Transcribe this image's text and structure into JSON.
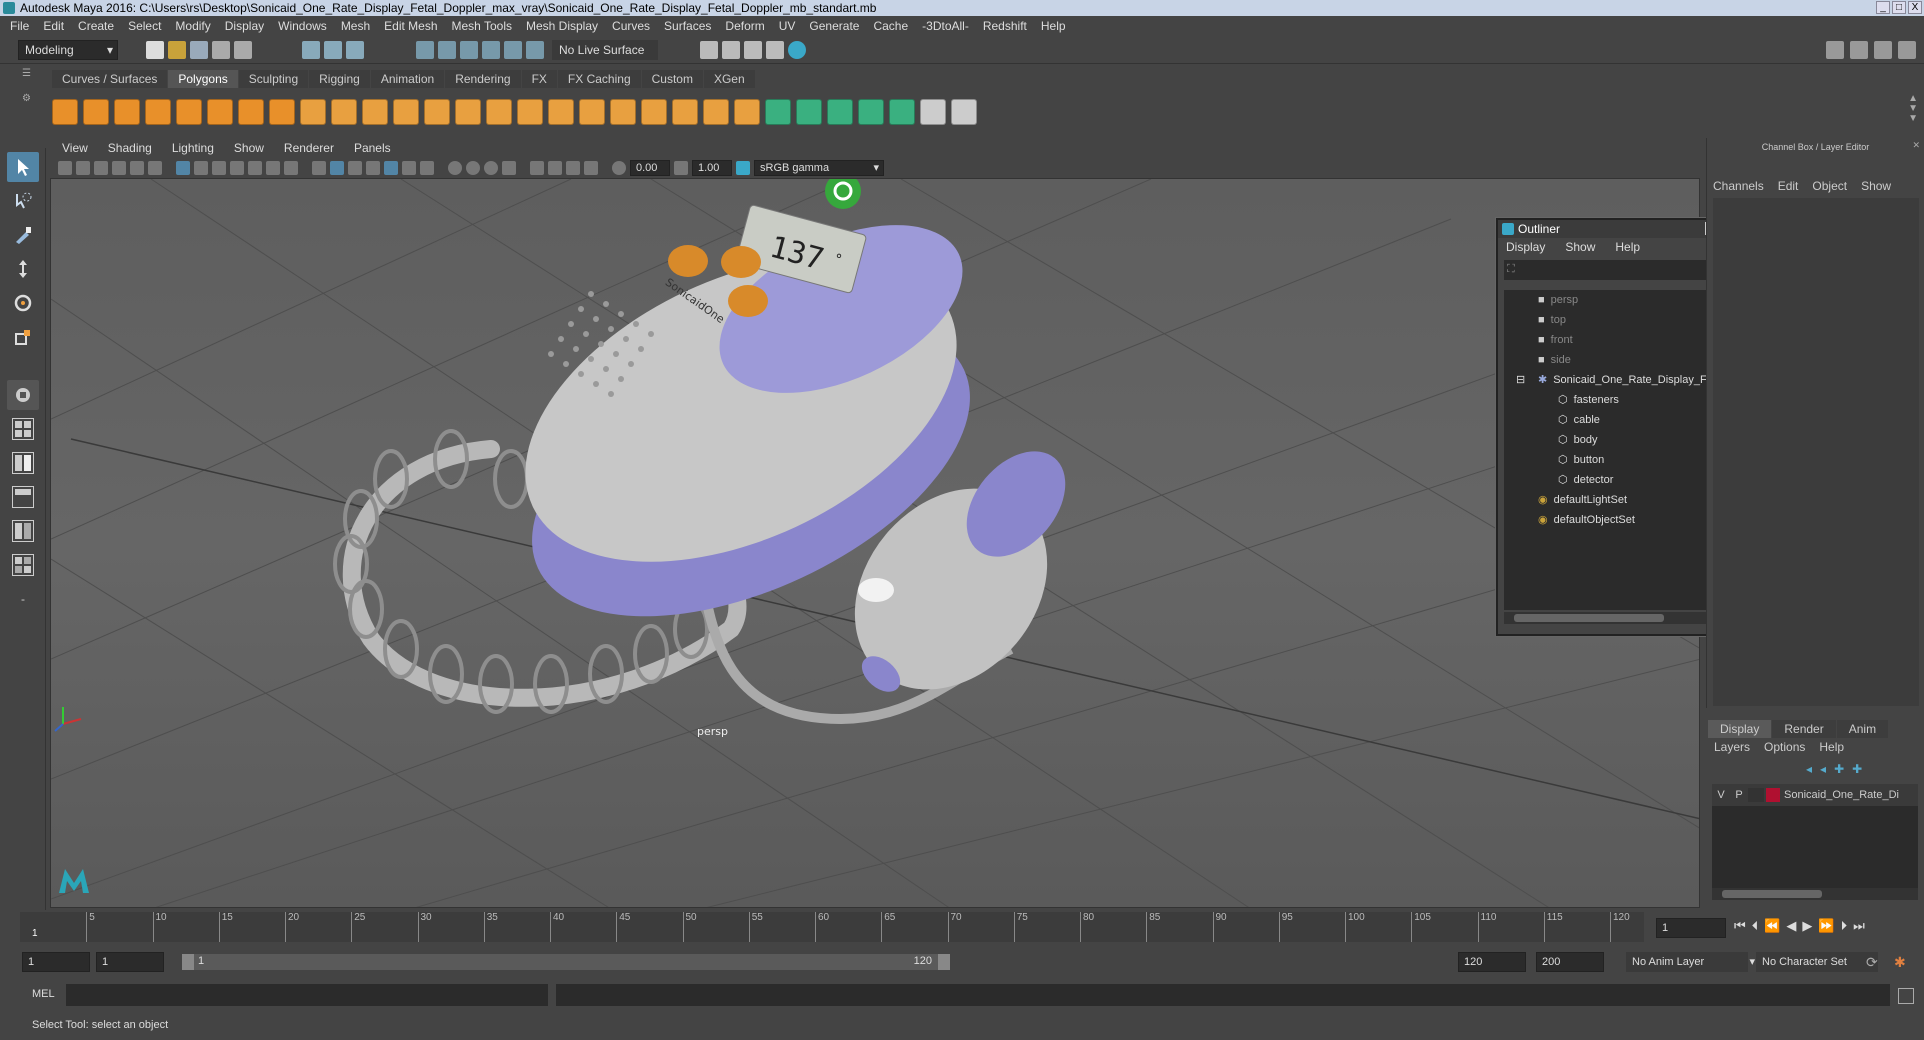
{
  "window": {
    "title": "Autodesk Maya 2016: C:\\Users\\rs\\Desktop\\Sonicaid_One_Rate_Display_Fetal_Doppler_max_vray\\Sonicaid_One_Rate_Display_Fetal_Doppler_mb_standart.mb",
    "buttons": [
      "_",
      "□",
      "X"
    ]
  },
  "menu": [
    "File",
    "Edit",
    "Create",
    "Select",
    "Modify",
    "Display",
    "Windows",
    "Mesh",
    "Edit Mesh",
    "Mesh Tools",
    "Mesh Display",
    "Curves",
    "Surfaces",
    "Deform",
    "UV",
    "Generate",
    "Cache",
    "-3DtoAll-",
    "Redshift",
    "Help"
  ],
  "statusline": {
    "mode": "Modeling",
    "live_surface": "No Live Surface"
  },
  "shelf": {
    "tabs": [
      "Curves / Surfaces",
      "Polygons",
      "Sculpting",
      "Rigging",
      "Animation",
      "Rendering",
      "FX",
      "FX Caching",
      "Custom",
      "XGen"
    ],
    "active_tab": "Polygons",
    "icon_colors": [
      "#e8902a",
      "#e8902a",
      "#e8902a",
      "#e8902a",
      "#e8902a",
      "#e8902a",
      "#e8902a",
      "#e8902a",
      "#e8a040",
      "#e8a040",
      "#e8a040",
      "#e8a040",
      "#e8a040",
      "#e8a040",
      "#e8a040",
      "#e8a040",
      "#e8a040",
      "#e8a040",
      "#e8a040",
      "#e8a040",
      "#e8a040",
      "#e8a040",
      "#e8a040",
      "#3ab080",
      "#3ab080",
      "#3ab080",
      "#3ab080",
      "#3ab080",
      "#cccccc",
      "#cccccc"
    ]
  },
  "viewport": {
    "menu": [
      "View",
      "Shading",
      "Lighting",
      "Show",
      "Renderer",
      "Panels"
    ],
    "exposure": "0.00",
    "gamma": "1.00",
    "colorspace": "sRGB gamma",
    "camera_label": "persp",
    "device": {
      "display": "137",
      "unit": "°",
      "brand": "SonicaidOne"
    }
  },
  "outliner": {
    "title": "Outliner",
    "menu": [
      "Display",
      "Show",
      "Help"
    ],
    "items": [
      {
        "label": "persp",
        "indent": 1,
        "dim": true,
        "icon": "camera-icon"
      },
      {
        "label": "top",
        "indent": 1,
        "dim": true,
        "icon": "camera-icon"
      },
      {
        "label": "front",
        "indent": 1,
        "dim": true,
        "icon": "camera-icon"
      },
      {
        "label": "side",
        "indent": 1,
        "dim": true,
        "icon": "camera-icon"
      },
      {
        "label": "Sonicaid_One_Rate_Display_Fetal",
        "indent": 1,
        "dim": false,
        "icon": "group-icon"
      },
      {
        "label": "fasteners",
        "indent": 2,
        "dim": false,
        "icon": "mesh-icon"
      },
      {
        "label": "cable",
        "indent": 2,
        "dim": false,
        "icon": "mesh-icon"
      },
      {
        "label": "body",
        "indent": 2,
        "dim": false,
        "icon": "mesh-icon"
      },
      {
        "label": "button",
        "indent": 2,
        "dim": false,
        "icon": "mesh-icon"
      },
      {
        "label": "detector",
        "indent": 2,
        "dim": false,
        "icon": "mesh-icon"
      },
      {
        "label": "defaultLightSet",
        "indent": 1,
        "dim": false,
        "icon": "set-icon"
      },
      {
        "label": "defaultObjectSet",
        "indent": 1,
        "dim": false,
        "icon": "set-icon"
      }
    ]
  },
  "channelbox": {
    "title": "Channel Box / Layer Editor",
    "menu": [
      "Channels",
      "Edit",
      "Object",
      "Show"
    ]
  },
  "layers": {
    "tabs": [
      "Display",
      "Render",
      "Anim"
    ],
    "active_tab": "Display",
    "menu": [
      "Layers",
      "Options",
      "Help"
    ],
    "row": {
      "v": "V",
      "p": "P",
      "name": "Sonicaid_One_Rate_Di",
      "color": "#b01030"
    }
  },
  "timeline": {
    "ticks": [
      "5",
      "10",
      "15",
      "20",
      "25",
      "30",
      "35",
      "40",
      "45",
      "50",
      "55",
      "60",
      "65",
      "70",
      "75",
      "80",
      "85",
      "90",
      "95",
      "100",
      "105",
      "110",
      "115",
      "120"
    ],
    "current_frame": "1",
    "start_marker": "1"
  },
  "range": {
    "start": "1",
    "playback_start": "1",
    "range_start_label": "1",
    "range_end_label": "120",
    "playback_end": "120",
    "end": "200",
    "anim_layer": "No Anim Layer",
    "character_set": "No Character Set"
  },
  "cmdline": {
    "label": "MEL"
  },
  "helpline": {
    "text": "Select Tool: select an object"
  }
}
